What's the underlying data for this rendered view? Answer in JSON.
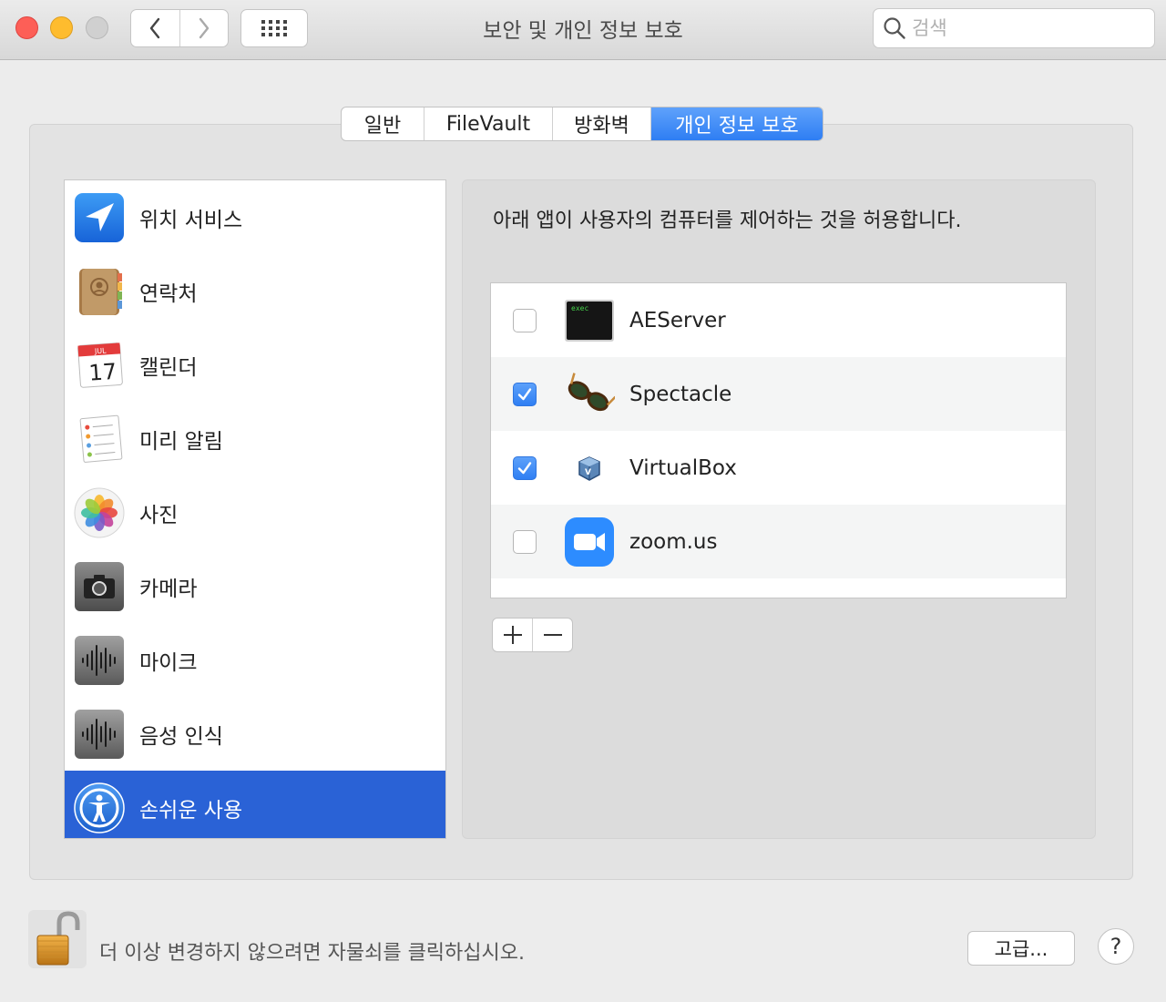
{
  "window": {
    "title": "보안 및 개인 정보 보호"
  },
  "search": {
    "placeholder": "검색"
  },
  "tabs": [
    {
      "label": "일반",
      "active": false
    },
    {
      "label": "FileVault",
      "active": false
    },
    {
      "label": "방화벽",
      "active": false
    },
    {
      "label": "개인 정보 보호",
      "active": true
    }
  ],
  "sidebar": {
    "items": [
      {
        "label": "위치 서비스",
        "icon": "location-icon"
      },
      {
        "label": "연락처",
        "icon": "contacts-icon"
      },
      {
        "label": "캘린더",
        "icon": "calendar-icon",
        "icon_month": "JUL",
        "icon_day": "17"
      },
      {
        "label": "미리 알림",
        "icon": "reminders-icon"
      },
      {
        "label": "사진",
        "icon": "photos-icon"
      },
      {
        "label": "카메라",
        "icon": "camera-icon"
      },
      {
        "label": "마이크",
        "icon": "microphone-icon"
      },
      {
        "label": "음성 인식",
        "icon": "speech-recognition-icon"
      },
      {
        "label": "손쉬운 사용",
        "icon": "accessibility-icon",
        "selected": true
      }
    ]
  },
  "main": {
    "description": "아래 앱이 사용자의 컴퓨터를 제어하는 것을 허용합니다.",
    "apps": [
      {
        "name": "AEServer",
        "checked": false,
        "icon": "terminal-exec-icon",
        "icon_text": "exec"
      },
      {
        "name": "Spectacle",
        "checked": true,
        "icon": "spectacle-glasses-icon"
      },
      {
        "name": "VirtualBox",
        "checked": true,
        "icon": "virtualbox-icon"
      },
      {
        "name": "zoom.us",
        "checked": false,
        "icon": "zoom-camera-icon"
      }
    ]
  },
  "footer": {
    "lock_text": "더 이상 변경하지 않으려면 자물쇠를 클릭하십시오.",
    "advanced_label": "고급...",
    "help_label": "?"
  },
  "colors": {
    "accent": "#2e7ef3",
    "selection": "#2a62d6",
    "close": "#fd5f57",
    "minimize": "#febc2e"
  }
}
